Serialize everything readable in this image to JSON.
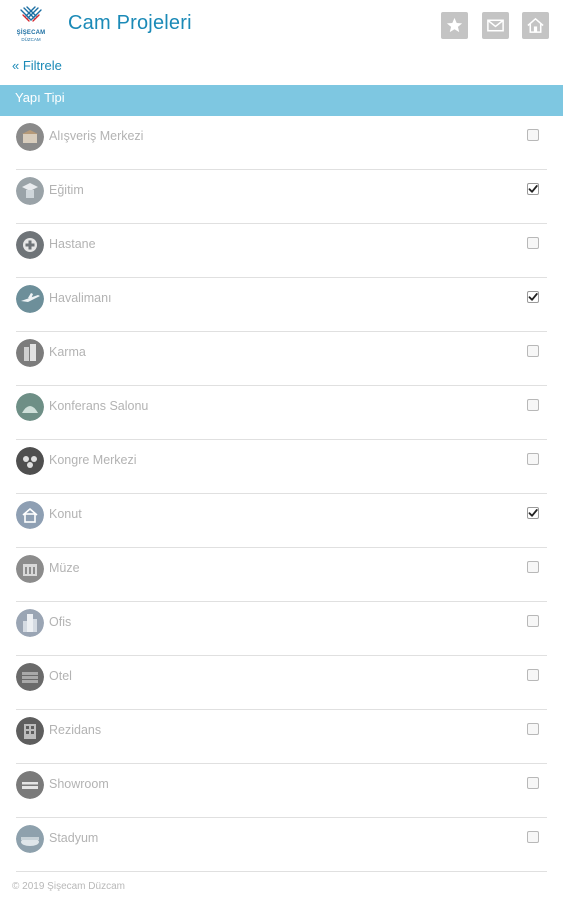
{
  "header": {
    "brand_line1": "ŞİŞECAM",
    "brand_line2": "DÜZCAM",
    "title": "Cam Projeleri",
    "icons": [
      "star-icon",
      "mail-icon",
      "home-icon"
    ]
  },
  "filter": {
    "label": "« Filtrele"
  },
  "section": {
    "title": "Yapı Tipi"
  },
  "items": [
    {
      "label": "Alışveriş Merkezi",
      "checked": false,
      "icon": "shopping-mall-icon"
    },
    {
      "label": "Eğitim",
      "checked": true,
      "icon": "education-icon"
    },
    {
      "label": "Hastane",
      "checked": false,
      "icon": "hospital-icon"
    },
    {
      "label": "Havalimanı",
      "checked": true,
      "icon": "airport-icon"
    },
    {
      "label": "Karma",
      "checked": false,
      "icon": "mixed-use-icon"
    },
    {
      "label": "Konferans Salonu",
      "checked": false,
      "icon": "conference-hall-icon"
    },
    {
      "label": "Kongre Merkezi",
      "checked": false,
      "icon": "congress-center-icon"
    },
    {
      "label": "Konut",
      "checked": true,
      "icon": "residence-icon"
    },
    {
      "label": "Müze",
      "checked": false,
      "icon": "museum-icon"
    },
    {
      "label": "Ofis",
      "checked": false,
      "icon": "office-icon"
    },
    {
      "label": "Otel",
      "checked": false,
      "icon": "hotel-icon"
    },
    {
      "label": "Rezidans",
      "checked": false,
      "icon": "residence-tower-icon"
    },
    {
      "label": "Showroom",
      "checked": false,
      "icon": "showroom-icon"
    },
    {
      "label": "Stadyum",
      "checked": false,
      "icon": "stadium-icon"
    }
  ],
  "footer": {
    "text": "© 2019 Şişecam Düzcam"
  },
  "colors": {
    "accent": "#1b8ab7",
    "section_bar": "#7ec7e1",
    "header_button": "#c4c4c4",
    "item_text": "#b3b3b3"
  }
}
